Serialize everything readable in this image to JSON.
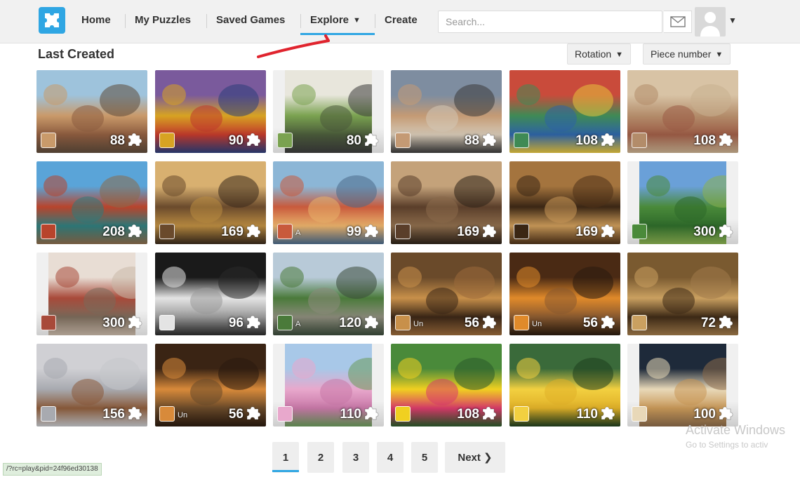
{
  "navbar": {
    "links": [
      "Home",
      "My Puzzles",
      "Saved Games",
      "Explore",
      "Create"
    ],
    "search_placeholder": "Search...",
    "active_link": "Explore"
  },
  "section": {
    "title": "Last Created",
    "sort_rotation": "Rotation",
    "sort_pieces": "Piece number"
  },
  "puzzles": [
    {
      "count": "88",
      "user": "",
      "colors": [
        "#9ec3dc",
        "#c99a6a",
        "#8d5c3f",
        "#5d4a3a"
      ]
    },
    {
      "count": "90",
      "user": "",
      "colors": [
        "#7a5a9c",
        "#d7a322",
        "#c0392b",
        "#2c3e7a"
      ]
    },
    {
      "count": "80",
      "user": "",
      "colors": [
        "#e8e6dc",
        "#7aa250",
        "#4a5a3a",
        "#3b3b3b"
      ]
    },
    {
      "count": "88",
      "user": "",
      "colors": [
        "#7e8da0",
        "#c49a74",
        "#d4c7b4",
        "#3a3a3a"
      ]
    },
    {
      "count": "108",
      "user": "",
      "colors": [
        "#c94b3b",
        "#3f8a55",
        "#2d63a5",
        "#e5c33c"
      ]
    },
    {
      "count": "108",
      "user": "",
      "colors": [
        "#d8c3a5",
        "#b38c6a",
        "#9b5b45",
        "#c8b090"
      ]
    },
    {
      "count": "208",
      "user": "",
      "colors": [
        "#5aa4d8",
        "#b8442c",
        "#2e7a7a",
        "#8a6a4a"
      ]
    },
    {
      "count": "169",
      "user": "",
      "colors": [
        "#d8b070",
        "#6a4a2c",
        "#b88a40",
        "#3a2a1c"
      ]
    },
    {
      "count": "99",
      "user": "A",
      "colors": [
        "#8cb6d6",
        "#c85a3c",
        "#e8b06a",
        "#4a6a8a"
      ]
    },
    {
      "count": "169",
      "user": "",
      "colors": [
        "#c4a27a",
        "#5a3e2a",
        "#8a6a4a",
        "#2e2218"
      ]
    },
    {
      "count": "169",
      "user": "",
      "colors": [
        "#a4743e",
        "#3a2614",
        "#c89858",
        "#4e3218"
      ]
    },
    {
      "count": "300",
      "user": "",
      "colors": [
        "#6aa0d8",
        "#4a8a3a",
        "#2e6a2a",
        "#8ab050"
      ]
    },
    {
      "count": "300",
      "user": "",
      "colors": [
        "#e8ddd4",
        "#a84a3a",
        "#7a6a5a",
        "#c8b8a8"
      ]
    },
    {
      "count": "96",
      "user": "",
      "colors": [
        "#1a1a1a",
        "#e4e4e4",
        "#9a9a9a",
        "#2a2a2a"
      ]
    },
    {
      "count": "120",
      "user": "A",
      "colors": [
        "#b8cad8",
        "#4a7a3a",
        "#8a8a7a",
        "#3a4a3a"
      ]
    },
    {
      "count": "56",
      "user": "Un",
      "colors": [
        "#6a4a2a",
        "#c8904a",
        "#3a2616",
        "#9a6a3a"
      ]
    },
    {
      "count": "56",
      "user": "Un",
      "colors": [
        "#4a2a14",
        "#e08a2a",
        "#8a5a30",
        "#2a1a0e"
      ]
    },
    {
      "count": "72",
      "user": "",
      "colors": [
        "#7a5a30",
        "#caa060",
        "#3e2a16",
        "#a07a4a"
      ]
    },
    {
      "count": "156",
      "user": "",
      "colors": [
        "#d0d0d4",
        "#a8aab0",
        "#8a5a3a",
        "#c4c6ca"
      ]
    },
    {
      "count": "56",
      "user": "Un",
      "colors": [
        "#3a2414",
        "#d88a3a",
        "#6a4a2a",
        "#2a1a0e"
      ]
    },
    {
      "count": "110",
      "user": "",
      "colors": [
        "#a8c8e8",
        "#e8a8cc",
        "#c878a8",
        "#6a9a5a"
      ]
    },
    {
      "count": "108",
      "user": "",
      "colors": [
        "#4a8a3a",
        "#f0d020",
        "#d83a6a",
        "#2a5a2a"
      ]
    },
    {
      "count": "110",
      "user": "",
      "colors": [
        "#3a6a3a",
        "#f2d040",
        "#e0b028",
        "#1e3e1e"
      ]
    },
    {
      "count": "100",
      "user": "",
      "colors": [
        "#1e2a3a",
        "#e8d8b8",
        "#c89858",
        "#8a6a4a"
      ]
    }
  ],
  "pagination": {
    "pages": [
      "1",
      "2",
      "3",
      "4",
      "5"
    ],
    "next": "Next ❯",
    "active_page": "1"
  },
  "status_bar": {
    "url": "/?rc=play&pid=24f96ed30138"
  },
  "watermark": {
    "title": "Activate Windows",
    "subtitle": "Go to Settings to activ"
  }
}
